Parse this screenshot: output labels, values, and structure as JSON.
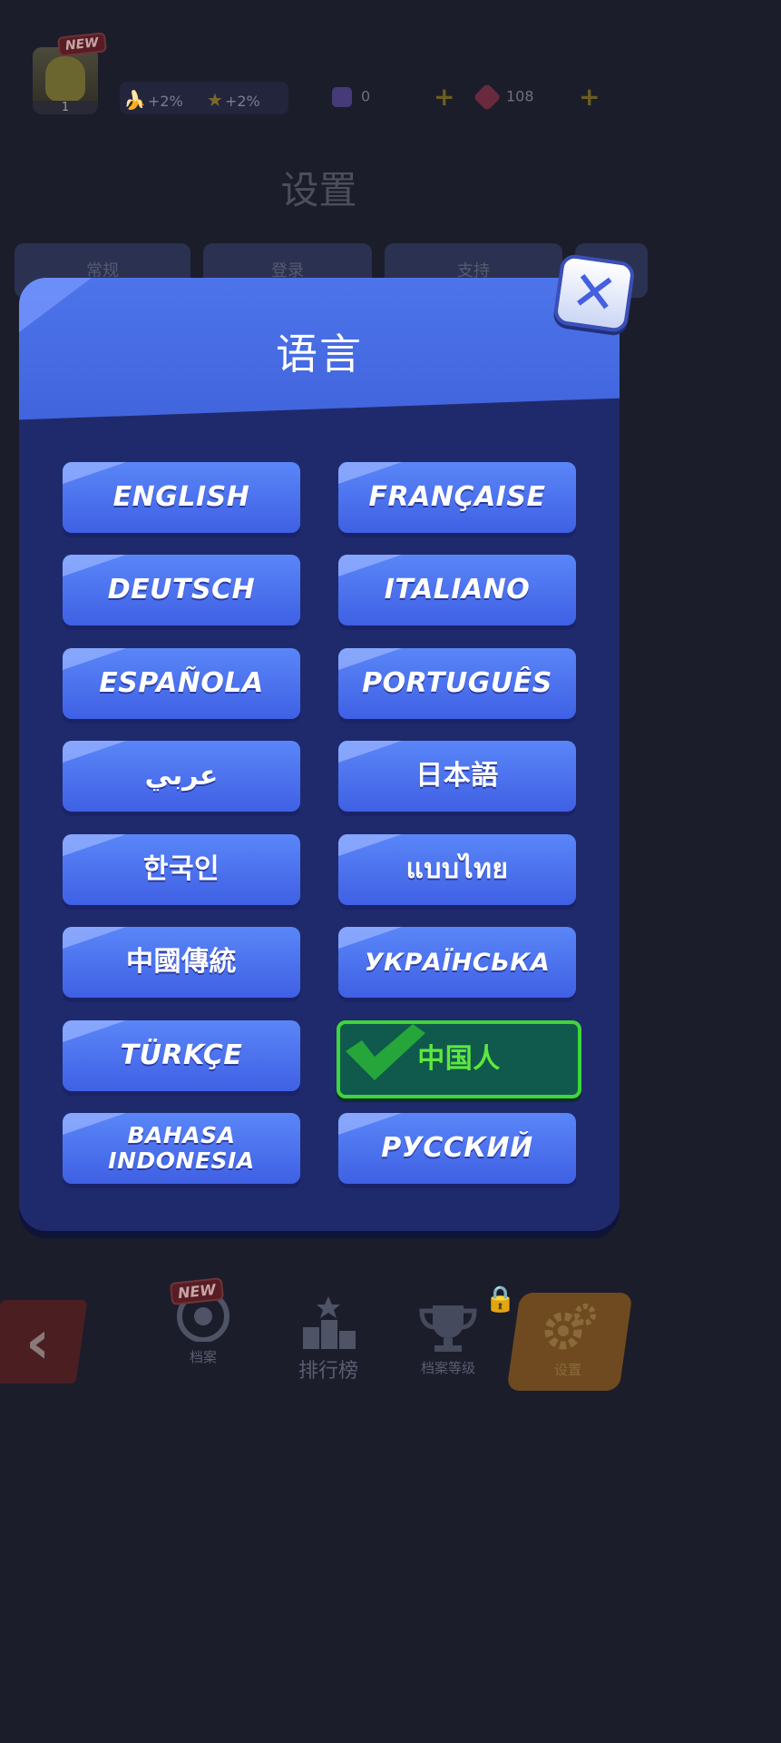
{
  "topbar": {
    "new_badge": "NEW",
    "avatar_level": "1",
    "boosts": [
      {
        "icon": "banana-icon",
        "value": "+2%"
      },
      {
        "icon": "star-icon",
        "value": "+2%"
      }
    ],
    "resources": [
      {
        "icon": "token-gem-icon",
        "value": "0"
      },
      {
        "icon": "red-gem-icon",
        "value": "108"
      }
    ],
    "plus_label": "+"
  },
  "settings": {
    "title": "设置",
    "tabs": [
      "常规",
      "登录",
      "支持",
      ""
    ]
  },
  "modal": {
    "title": "语言",
    "close_icon": "close-icon",
    "languages": [
      {
        "label": "ENGLISH",
        "selected": false
      },
      {
        "label": "FRANÇAISE",
        "selected": false
      },
      {
        "label": "DEUTSCH",
        "selected": false
      },
      {
        "label": "ITALIANO",
        "selected": false
      },
      {
        "label": "ESPAÑOLA",
        "selected": false
      },
      {
        "label": "PORTUGUÊS",
        "selected": false
      },
      {
        "label": "عربي",
        "selected": false
      },
      {
        "label": "日本語",
        "selected": false
      },
      {
        "label": "한국인",
        "selected": false
      },
      {
        "label": "แบบไทย",
        "selected": false
      },
      {
        "label": "中國傳統",
        "selected": false
      },
      {
        "label": "УКРАЇНСЬКА",
        "selected": false
      },
      {
        "label": "TÜRKÇE",
        "selected": false
      },
      {
        "label": "中国人",
        "selected": true
      },
      {
        "label_line1": "BAHASA",
        "label_line2": "INDONESIA",
        "selected": false
      },
      {
        "label": "РУССКИЙ",
        "selected": false
      }
    ]
  },
  "bottom_nav": {
    "new_badge": "NEW",
    "items": [
      {
        "label": "档案",
        "icon": "profile-badge-icon"
      },
      {
        "label": "排行榜",
        "icon": "leaderboard-icon"
      },
      {
        "label": "档案等级",
        "icon": "trophy-icon"
      },
      {
        "label": "设置",
        "icon": "gear-icon"
      }
    ]
  },
  "colors": {
    "modal_bg": "#1f2a6c",
    "header_blue": "#4d74ea",
    "button_blue": "#4f74f0",
    "selected_green": "#3fd63a"
  }
}
